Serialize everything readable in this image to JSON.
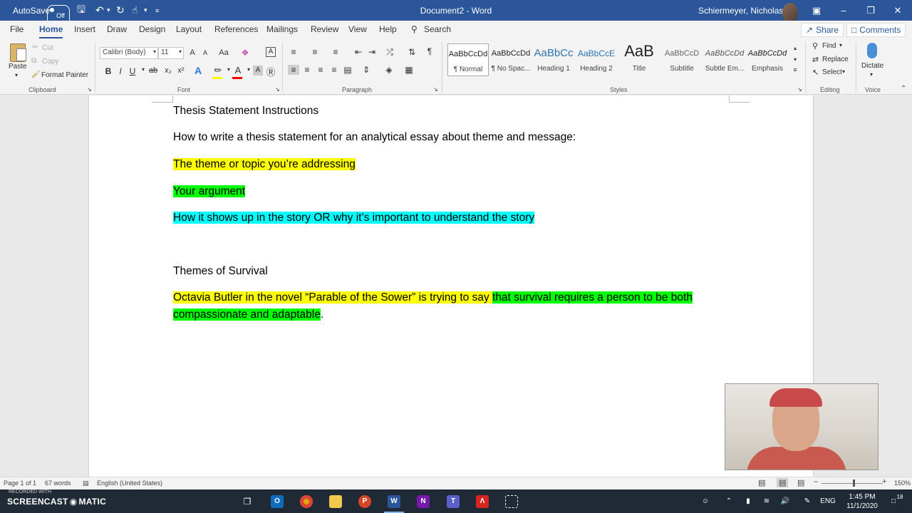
{
  "titlebar": {
    "autosave_label": "AutoSave",
    "autosave_state": "Off",
    "document_title": "Document2 - Word",
    "user_name": "Schiermeyer, Nicholas W",
    "quick_access": [
      "save-icon",
      "undo-icon",
      "redo-icon",
      "touch-mode-icon",
      "customize-icon"
    ]
  },
  "tabs": {
    "items": [
      "File",
      "Home",
      "Insert",
      "Draw",
      "Design",
      "Layout",
      "References",
      "Mailings",
      "Review",
      "View",
      "Help"
    ],
    "active": "Home",
    "search_label": "Search",
    "share_label": "Share",
    "comments_label": "Comments"
  },
  "ribbon": {
    "clipboard": {
      "label": "Clipboard",
      "paste": "Paste",
      "cut": "Cut",
      "copy": "Copy",
      "format_painter": "Format Painter"
    },
    "font": {
      "label": "Font",
      "font_name": "Calibri (Body)",
      "font_size": "11",
      "bold": "B",
      "italic": "I",
      "underline": "U",
      "strike": "ab",
      "subscript": "x₂",
      "superscript": "x²",
      "grow": "A",
      "shrink": "A",
      "change_case": "Aa",
      "highlight_color": "#ffff00",
      "font_color": "#ff0000"
    },
    "paragraph": {
      "label": "Paragraph"
    },
    "styles": {
      "label": "Styles",
      "items": [
        {
          "sample": "AaBbCcDd",
          "name": "¶ Normal"
        },
        {
          "sample": "AaBbCcDd",
          "name": "¶ No Spac..."
        },
        {
          "sample": "AaBbCc",
          "name": "Heading 1"
        },
        {
          "sample": "AaBbCcE",
          "name": "Heading 2"
        },
        {
          "sample": "AaB",
          "name": "Title"
        },
        {
          "sample": "AaBbCcD",
          "name": "Subtitle"
        },
        {
          "sample": "AaBbCcDd",
          "name": "Subtle Em..."
        },
        {
          "sample": "AaBbCcDd",
          "name": "Emphasis"
        }
      ]
    },
    "editing": {
      "label": "Editing",
      "find": "Find",
      "replace": "Replace",
      "select": "Select"
    },
    "voice": {
      "label": "Voice",
      "dictate": "Dictate"
    }
  },
  "document": {
    "p1": "Thesis Statement Instructions",
    "p2": "How to write a thesis statement for an analytical essay about theme and message:",
    "p3": "The theme or topic you’re addressing",
    "p4": "Your argument",
    "p5": "How it shows up in the story OR why it’s important to understand the story",
    "p6": "Themes of Survival",
    "p7a": "Octavia Butler in the novel “Parable of the Sower” is trying to say ",
    "p7b": "that survival requires a person to be both compassionate and adaptable",
    "p7c": ".",
    "highlight_colors": {
      "yellow": "#ffff00",
      "green": "#00ff00",
      "cyan": "#00ffff"
    }
  },
  "statusbar": {
    "page": "Page 1 of 1",
    "words": "67 words",
    "language": "English (United States)",
    "zoom": "150%"
  },
  "taskbar": {
    "recorder_brand": "SCREENCAST",
    "recorder_brand_suffix": "MATIC",
    "recorded_with": "RECORDED WITH",
    "language": "ENG",
    "time": "1:45 PM",
    "date": "11/1/2020",
    "notifications": "18"
  }
}
